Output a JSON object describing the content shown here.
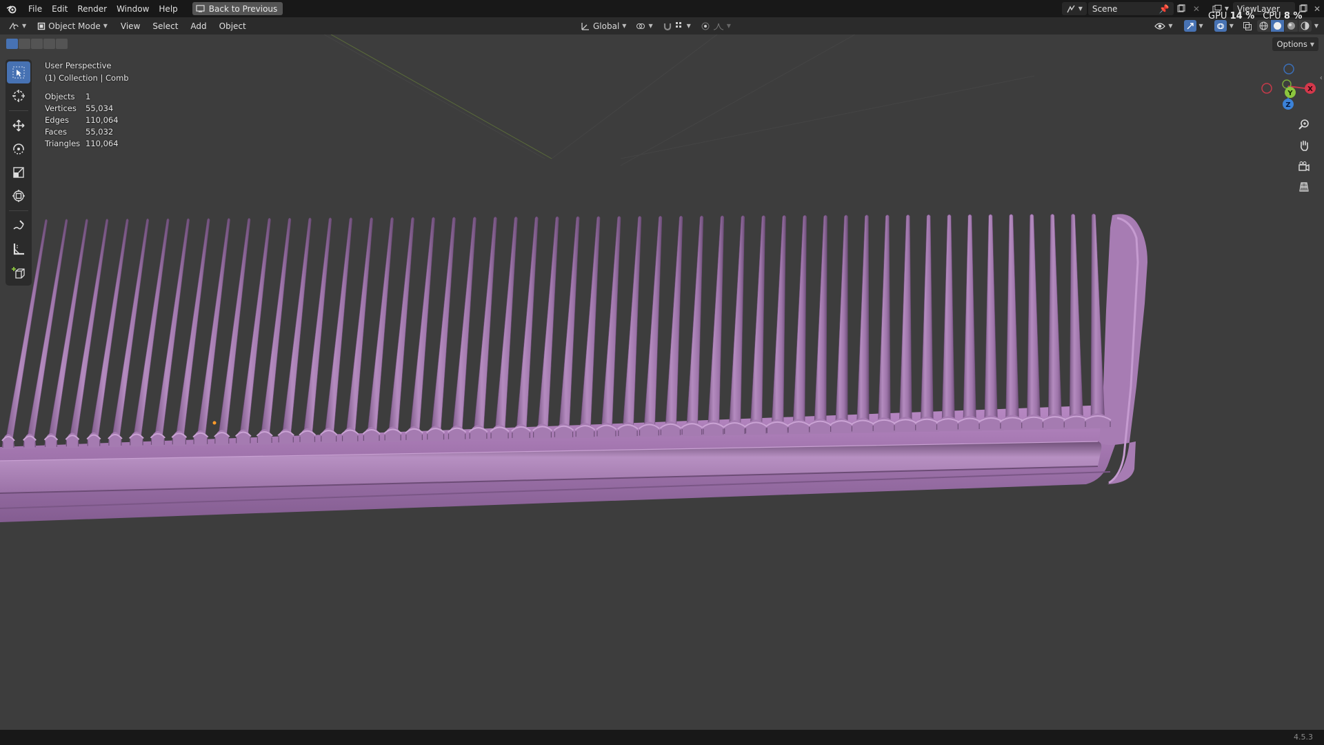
{
  "topbar": {
    "menus": [
      "File",
      "Edit",
      "Render",
      "Window",
      "Help"
    ],
    "back_button": "Back to Previous",
    "scene_label": "Scene",
    "viewlayer_label": "ViewLayer",
    "gpu_label": "GPU",
    "gpu_value": "14 %",
    "cpu_label": "CPU",
    "cpu_value": "8 %"
  },
  "header": {
    "mode": "Object Mode",
    "menus": [
      "View",
      "Select",
      "Add",
      "Object"
    ],
    "transform_orientation": "Global",
    "options_label": "Options"
  },
  "overlay": {
    "view_name": "User Perspective",
    "collection": "(1) Collection | Comb",
    "stats": [
      {
        "label": "Objects",
        "value": "1"
      },
      {
        "label": "Vertices",
        "value": "55,034"
      },
      {
        "label": "Edges",
        "value": "110,064"
      },
      {
        "label": "Faces",
        "value": "55,032"
      },
      {
        "label": "Triangles",
        "value": "110,064"
      }
    ]
  },
  "gizmo": {
    "x_label": "X",
    "y_label": "Y",
    "z_label": "Z"
  },
  "status": {
    "version": "4.5.3"
  },
  "colors": {
    "comb": "#9a6fa6",
    "accent": "#4772b3",
    "background": "#3d3d3d"
  }
}
